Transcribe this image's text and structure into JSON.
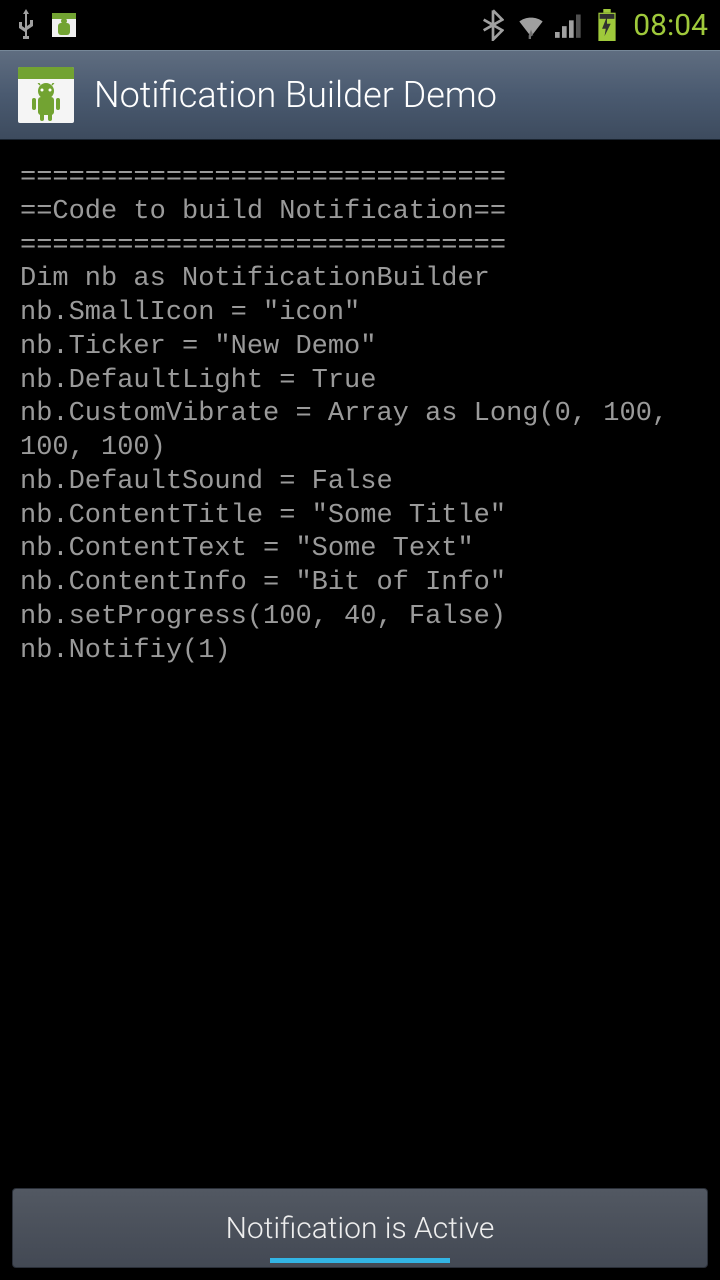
{
  "status": {
    "time": "08:04"
  },
  "actionbar": {
    "title": "Notification Builder Demo"
  },
  "code": {
    "line1": "==============================",
    "line2": "==Code to build Notification==",
    "line3": "==============================",
    "line4": "Dim nb as NotificationBuilder",
    "line5": "nb.SmallIcon = \"icon\"",
    "line6": "nb.Ticker = \"New Demo\"",
    "line7": "nb.DefaultLight = True",
    "line8": "nb.CustomVibrate = Array as Long(0, 100, 100, 100)",
    "line9": "nb.DefaultSound = False",
    "line10": "nb.ContentTitle = \"Some Title\"",
    "line11": "nb.ContentText = \"Some Text\"",
    "line12": "nb.ContentInfo = \"Bit of Info\"",
    "line13": "nb.setProgress(100, 40, False)",
    "line14": "nb.Notifiy(1)"
  },
  "button": {
    "label": "Notification is Active"
  }
}
